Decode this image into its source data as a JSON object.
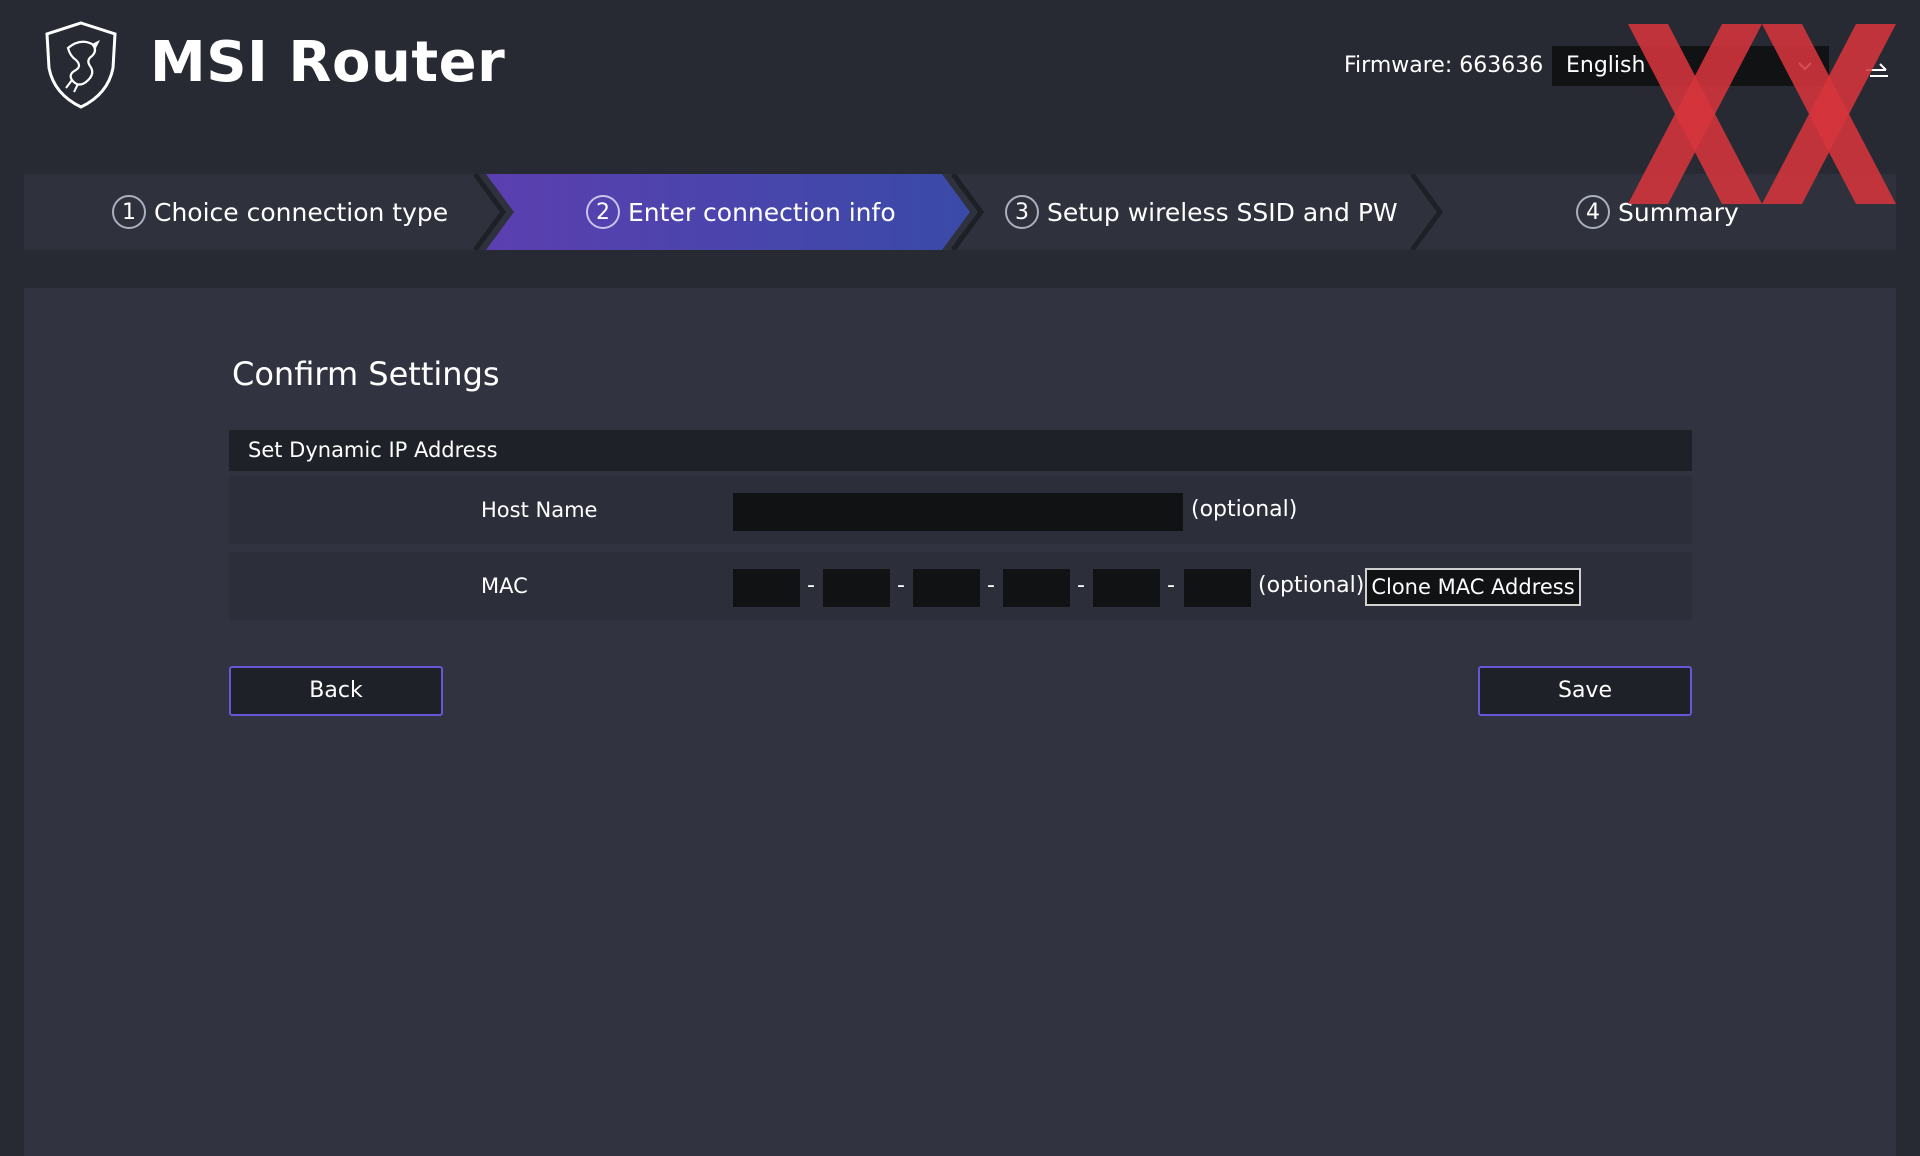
{
  "header": {
    "title": "MSI Router",
    "firmware": "Firmware: 663636",
    "language": "English"
  },
  "icons": {
    "logo": "msi-dragon-shield-icon",
    "language_caret": "chevron-down-icon",
    "logout": "logout-arrow-icon"
  },
  "steps": [
    {
      "num": "1",
      "label": "Choice connection type",
      "active": false
    },
    {
      "num": "2",
      "label": "Enter connection info",
      "active": true
    },
    {
      "num": "3",
      "label": "Setup wireless SSID and PW",
      "active": false
    },
    {
      "num": "4",
      "label": "Summary",
      "active": false
    }
  ],
  "main": {
    "title": "Confirm Settings",
    "section": "Set Dynamic IP Address",
    "host_name": {
      "label": "Host Name",
      "value": "",
      "hint": "(optional)"
    },
    "mac": {
      "label": "MAC",
      "octets": [
        "",
        "",
        "",
        "",
        "",
        ""
      ],
      "separator": "-",
      "hint": "(optional)",
      "clone_label": "Clone MAC Address"
    },
    "back_label": "Back",
    "save_label": "Save"
  },
  "colors": {
    "background": "#272a33",
    "panel": "#313440",
    "active_step_start": "#5b3fb0",
    "active_step_end": "#3a4aa8",
    "button_border": "#6a55d6",
    "input": "#111214",
    "watermark": "#d6343c"
  }
}
